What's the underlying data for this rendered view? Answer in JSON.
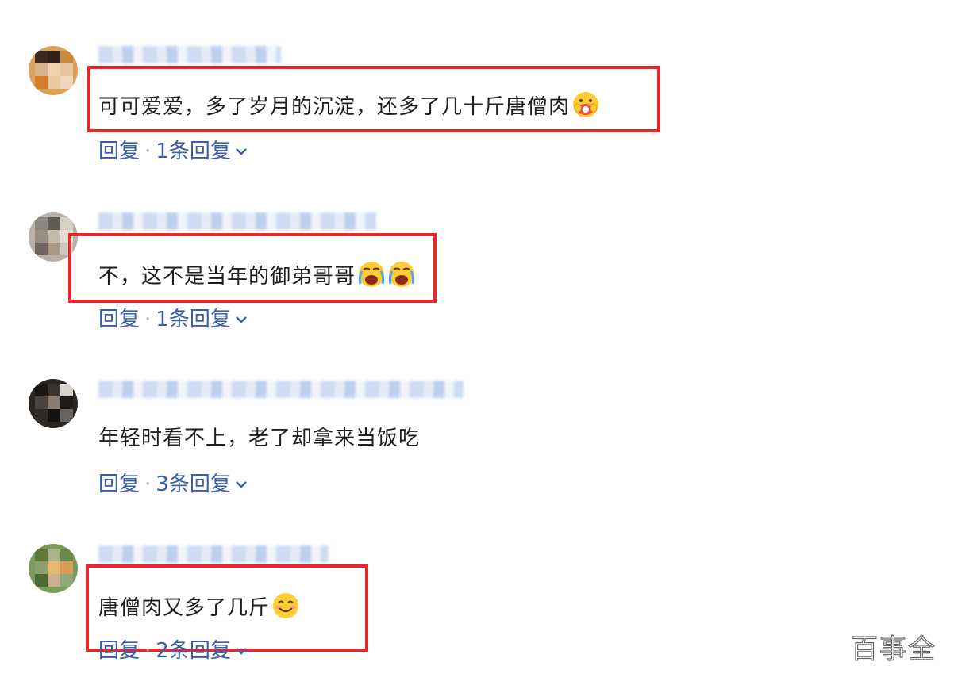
{
  "comments": [
    {
      "text": "可可爱爱，多了岁月的沉淀，还多了几十斤唐僧肉",
      "emoji": "mask-face-emoji",
      "reply_label": "回复",
      "separator": "·",
      "reply_count_label": "1条回复",
      "highlighted": true
    },
    {
      "text": "不，这不是当年的御弟哥哥",
      "emoji": "crying-face-emoji",
      "reply_label": "回复",
      "separator": "·",
      "reply_count_label": "1条回复",
      "highlighted": true
    },
    {
      "text": "年轻时看不上，老了却拿来当饭吃",
      "reply_label": "回复",
      "separator": "·",
      "reply_count_label": "3条回复",
      "highlighted": false
    },
    {
      "text": "唐僧肉又多了几斤",
      "emoji": "smiling-face-emoji",
      "reply_label": "回复",
      "separator": "·",
      "reply_count_label": "2条回复",
      "highlighted": true
    }
  ],
  "watermark": "百事全",
  "colors": {
    "highlight_border": "#e8262b",
    "link_blue": "#3a5fa8",
    "text": "#1f1f1f"
  },
  "icons": [
    "chevron-down-icon"
  ]
}
